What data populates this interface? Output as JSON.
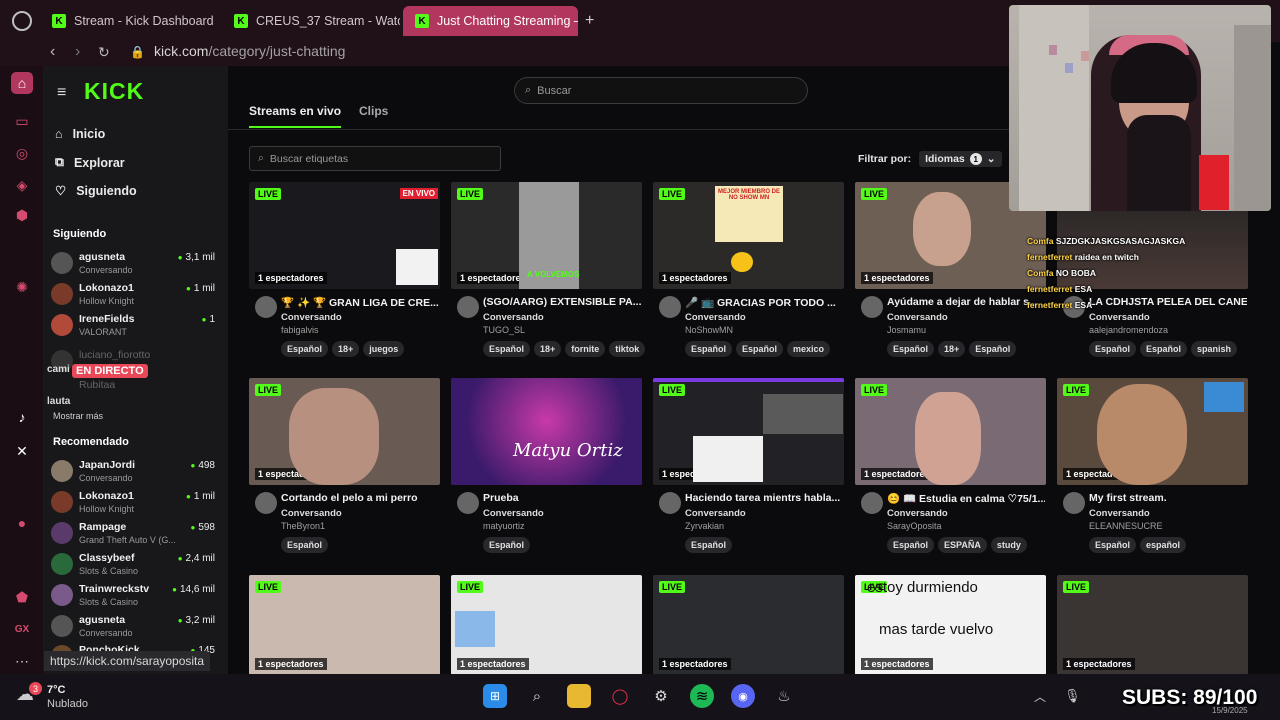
{
  "browser": {
    "tabs": [
      {
        "label": "Stream - Kick Dashboard"
      },
      {
        "label": "CREUS_37 Stream - Wato"
      },
      {
        "label": "Just Chatting Streaming –"
      }
    ],
    "url_domain": "kick.com",
    "url_path": "/category/just-chatting",
    "status_url": "https://kick.com/sarayoposita"
  },
  "kick": {
    "logo": "KICK",
    "search_placeholder": "Buscar",
    "nav": [
      {
        "label": "Inicio",
        "icon": "home-icon"
      },
      {
        "label": "Explorar",
        "icon": "compass-icon"
      },
      {
        "label": "Siguiendo",
        "icon": "heart-icon"
      }
    ],
    "following_header": "Siguiendo",
    "following": [
      {
        "name": "agusneta",
        "category": "Conversando",
        "viewers": "3,1 mil"
      },
      {
        "name": "Lokonazo1",
        "category": "Hollow Knight",
        "viewers": "1 mil"
      },
      {
        "name": "IreneFields",
        "category": "VALORANT",
        "viewers": "1"
      },
      {
        "name": "luciano_fiorotto",
        "category": "",
        "viewers": ""
      },
      {
        "name": "cami",
        "category": "",
        "viewers": ""
      },
      {
        "name": "Rubitaa",
        "category": "",
        "viewers": ""
      },
      {
        "name": "lauta",
        "category": "",
        "viewers": ""
      }
    ],
    "en_directo": "EN DIRECTO",
    "show_more": "Mostrar más",
    "recommended_header": "Recomendado",
    "recommended": [
      {
        "name": "JapanJordi",
        "category": "Conversando",
        "viewers": "498"
      },
      {
        "name": "Lokonazo1",
        "category": "Hollow Knight",
        "viewers": "1 mil"
      },
      {
        "name": "Rampage",
        "category": "Grand Theft Auto V (G...",
        "viewers": "598"
      },
      {
        "name": "Classybeef",
        "category": "Slots & Casino",
        "viewers": "2,4 mil"
      },
      {
        "name": "Trainwreckstv",
        "category": "Slots & Casino",
        "viewers": "14,6 mil"
      },
      {
        "name": "agusneta",
        "category": "Conversando",
        "viewers": "3,2 mil"
      },
      {
        "name": "PonchoKick",
        "category": "",
        "viewers": "145"
      }
    ],
    "content_tabs": [
      "Streams en vivo",
      "Clips"
    ],
    "tag_search_placeholder": "Buscar etiquetas",
    "filter_label": "Filtrar por:",
    "filter_value": "Idiomas",
    "filter_count": "1",
    "live_label": "LIVE",
    "viewers_label": "1 espectadores",
    "streams": [
      {
        "title": "🏆 ✨ 🏆 GRAN LIGA DE CRE...",
        "category": "Conversando",
        "user": "fabigalvis",
        "tags": [
          "Español",
          "18+",
          "juegos"
        ],
        "thumb": "#1a1a1e"
      },
      {
        "title": "(SGO/AARG) EXTENSIBLE PA...",
        "category": "Conversando",
        "user": "TUGO_SL",
        "tags": [
          "Español",
          "18+",
          "fornite",
          "tiktok"
        ],
        "thumb": "#2a2a2a"
      },
      {
        "title": "🎤 📺 GRACIAS POR TODO ...",
        "category": "Conversando",
        "user": "NoShowMN",
        "tags": [
          "Español",
          "Español",
          "mexico"
        ],
        "thumb": "#2b2a28"
      },
      {
        "title": "Ayúdame a dejar de hablar s...",
        "category": "Conversando",
        "user": "Josmamu",
        "tags": [
          "Español",
          "18+",
          "Español"
        ],
        "thumb": "#6e5f54"
      },
      {
        "title": "LA CDHJSTA PELEA DEL CANE...",
        "category": "Conversando",
        "user": "aalejandromendoza",
        "tags": [
          "Español",
          "Español",
          "spanish"
        ],
        "thumb": "#3a2e2c"
      },
      {
        "title": "Cortando el pelo a mi perro",
        "category": "Conversando",
        "user": "TheByron1",
        "tags": [
          "Español"
        ],
        "thumb": "#6a5a54"
      },
      {
        "title": "Prueba",
        "category": "Conversando",
        "user": "matyuortiz",
        "tags": [
          "Español"
        ],
        "thumb": "#4a1f6a"
      },
      {
        "title": "Haciendo tarea mientrs habla...",
        "category": "Conversando",
        "user": "Zyrvakian",
        "tags": [
          "Español"
        ],
        "thumb": "#222226"
      },
      {
        "title": "😊 📖 Estudia en calma ♡75/1...",
        "category": "Conversando",
        "user": "SarayOposita",
        "tags": [
          "Español",
          "ESPAÑA",
          "study"
        ],
        "thumb": "#7a6a74"
      },
      {
        "title": "My first stream.",
        "category": "Conversando",
        "user": "ELEANNESUCRE",
        "tags": [
          "Español",
          "español"
        ],
        "thumb": "#5a4a3e"
      },
      {
        "title": "",
        "category": "",
        "user": "",
        "tags": [],
        "thumb": "#c9b9ae"
      },
      {
        "title": "",
        "category": "",
        "user": "",
        "tags": [],
        "thumb": "#e6e6e6"
      },
      {
        "title": "",
        "category": "",
        "user": "",
        "tags": [],
        "thumb": "#2a2c30"
      },
      {
        "title": "",
        "category": "",
        "user": "",
        "tags": [],
        "thumb": "#f2f2f2"
      },
      {
        "title": "",
        "category": "",
        "user": "",
        "tags": [],
        "thumb": "#3a3432"
      }
    ],
    "thumb_overlays": {
      "en_vivo": "EN VIVO",
      "volvemos": "A VOLVEMOS",
      "noshow": "MEJOR MIEMBRO DE NO SHOW MN",
      "matyortiz": "Matyu Ortiz",
      "sleep1": "estoy durmiendo",
      "sleep2": "mas tarde vuelvo"
    }
  },
  "chat_overlay": [
    {
      "user": "Comfa",
      "msg": "SJZDGKJASKGSASAGJASKGA"
    },
    {
      "user": "fernetferret",
      "msg": "raidea en twitch"
    },
    {
      "user": "Comfa",
      "msg": "NO BOBA"
    },
    {
      "user": "fernetferret",
      "msg": "ESA"
    },
    {
      "user": "fernetferret",
      "msg": "ESA"
    }
  ],
  "taskbar": {
    "weather_temp": "7°C",
    "weather_desc": "Nublado",
    "weather_badge": "3",
    "subs": "SUBS: 89/100",
    "date": "15/9/2025"
  },
  "colors": {
    "kick_green": "#53fc18",
    "tab_active": "#b2375f",
    "live_badge": "#e84857"
  }
}
